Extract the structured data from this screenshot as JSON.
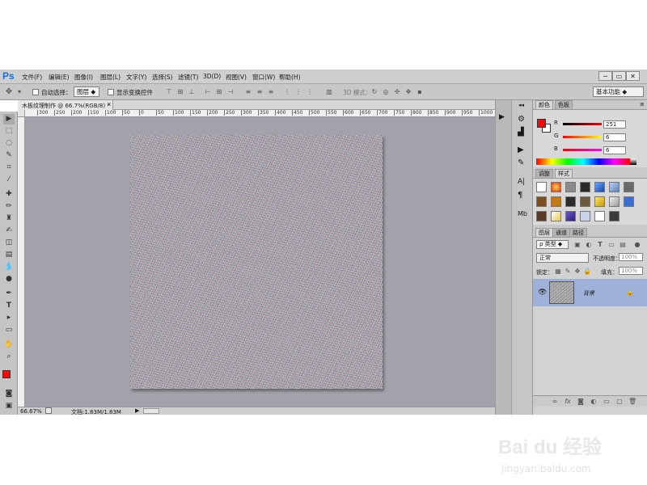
{
  "app": {
    "logo": "Ps"
  },
  "menu": [
    "文件(F)",
    "编辑(E)",
    "图像(I)",
    "图层(L)",
    "文字(Y)",
    "选择(S)",
    "滤镜(T)",
    "3D(D)",
    "视图(V)",
    "窗口(W)",
    "帮助(H)"
  ],
  "window_controls": [
    "─",
    "▭",
    "✕"
  ],
  "options": {
    "auto_select_label": "自动选择：",
    "auto_select_value": "图层",
    "show_transform_label": "显示变换控件",
    "mode_3d_label": "3D 模式：",
    "workspace": "基本功能"
  },
  "document": {
    "tab_title": "木板纹理制作 @ 66.7%(RGB/8) *",
    "zoom": "66.67%",
    "doc_info": "文档:1.83M/1.83M"
  },
  "ruler": {
    "top_ticks": [
      "300",
      "250",
      "200",
      "150",
      "100",
      "50",
      "0",
      "50",
      "100",
      "150",
      "200",
      "250",
      "300",
      "350",
      "400",
      "450",
      "500",
      "550",
      "600",
      "650",
      "700",
      "750",
      "800",
      "850",
      "900",
      "950",
      "1000",
      "1050"
    ]
  },
  "color_panel": {
    "tabs": [
      "颜色",
      "色板"
    ],
    "r_label": "R",
    "g_label": "G",
    "b_label": "B",
    "r_value": "251",
    "g_value": "6",
    "b_value": "6",
    "fg_color": "#fb0606",
    "bg_color": "#ffffff"
  },
  "styles_panel": {
    "tabs": [
      "调整",
      "样式"
    ]
  },
  "layers_panel": {
    "tabs": [
      "图层",
      "通道",
      "路径"
    ],
    "kind_label": "ρ 类型",
    "blend_mode": "正常",
    "opacity_label": "不透明度：",
    "opacity_value": "100%",
    "lock_label": "锁定：",
    "fill_label": "填充：",
    "fill_value": "100%",
    "layers": [
      {
        "name": "背景"
      }
    ]
  },
  "watermark": {
    "brand": "Bai du 经验",
    "url": "jingyan.baidu.com"
  }
}
